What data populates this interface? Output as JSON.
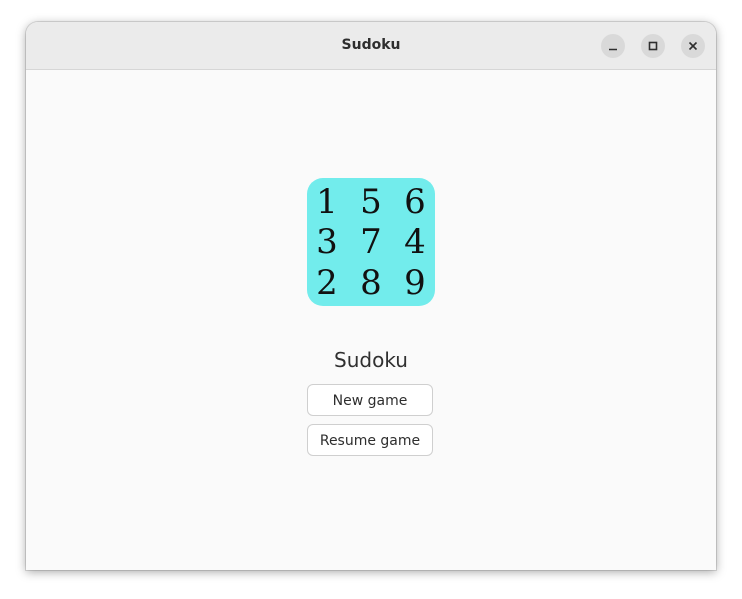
{
  "window": {
    "title": "Sudoku"
  },
  "icon": {
    "digits": [
      "1",
      "5",
      "6",
      "3",
      "7",
      "4",
      "2",
      "8",
      "9"
    ],
    "background_color": "#72ecec"
  },
  "main": {
    "app_name": "Sudoku",
    "new_game_label": "New game",
    "resume_game_label": "Resume game"
  }
}
